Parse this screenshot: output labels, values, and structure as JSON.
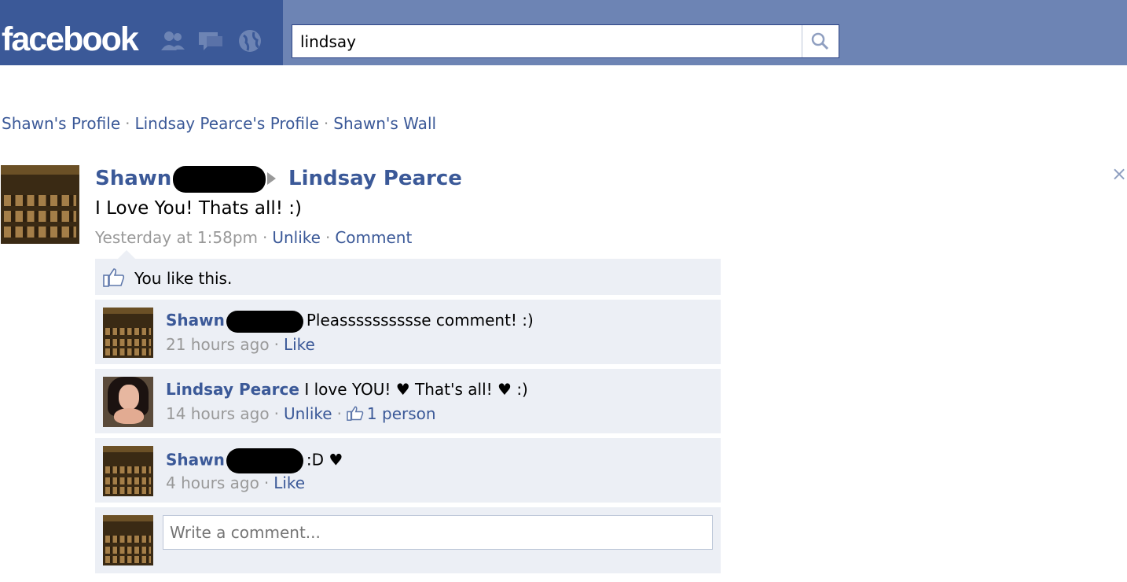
{
  "topbar": {
    "logo": "facebook",
    "jewels": [
      "friend-requests-icon",
      "messages-icon",
      "notifications-icon"
    ],
    "search_value": "lindsay",
    "colors": {
      "bar": "#3b5998",
      "strip": "#6d84b4"
    }
  },
  "breadcrumb": {
    "items": [
      "Shawn's Profile",
      "Lindsay Pearce's Profile",
      "Shawn's Wall"
    ],
    "separator": "·"
  },
  "post": {
    "author": "Shawn",
    "target": "Lindsay Pearce",
    "text": "I Love You! Thats all! :)",
    "timestamp": "Yesterday at 1:58pm",
    "unlike_label": "Unlike",
    "comment_label": "Comment",
    "close_label": "×"
  },
  "likes": {
    "text": "You like this."
  },
  "comments": [
    {
      "author": "Shawn",
      "text": "Pleasssssssssse comment! :)",
      "time": "21 hours ago",
      "action": "Like"
    },
    {
      "author": "Lindsay Pearce",
      "text": "I love YOU! ♥ That's all! ♥ :)",
      "time": "14 hours ago",
      "action": "Unlike",
      "like_count": "1 person"
    },
    {
      "author": "Shawn",
      "text": ":D ♥",
      "time": "4 hours ago",
      "action": "Like"
    }
  ],
  "write_comment": {
    "placeholder": "Write a comment..."
  }
}
